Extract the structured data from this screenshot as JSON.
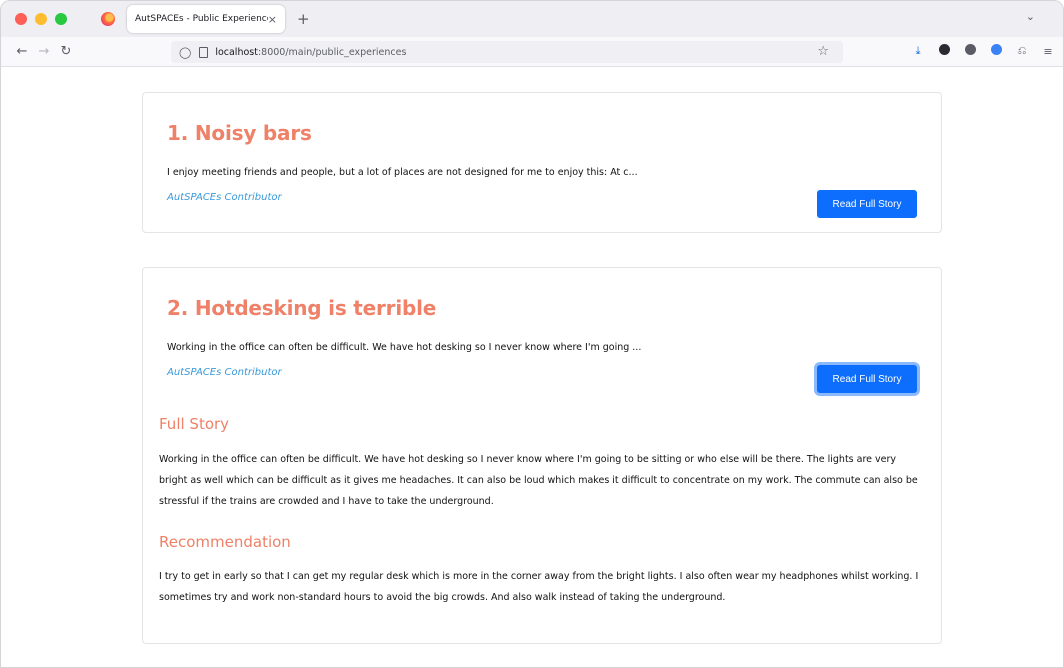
{
  "browser": {
    "tab_title": "AutSPACEs - Public Experiences",
    "tab_close": "×",
    "new_tab": "+",
    "tab_list": "⌄",
    "url_host": "localhost",
    "url_rest": ":8000/main/public_experiences"
  },
  "stories": [
    {
      "title": "1. Noisy bars",
      "excerpt": "I enjoy meeting friends and people, but a lot of places are not designed for me to enjoy this: At c...",
      "author": "AutSPACEs Contributor",
      "button_label": "Read Full Story"
    },
    {
      "title": "2. Hotdesking is terrible",
      "excerpt": "Working in the office can often be difficult. We have hot desking so I never know where I'm going ...",
      "author": "AutSPACEs Contributor",
      "button_label": "Read Full Story",
      "full_story_heading": "Full Story",
      "full_story": "Working in the office can often be difficult. We have hot desking so I never know where I'm going to be sitting or who else will be there. The lights are very bright as well which can be difficult as it gives me headaches. It can also be loud which makes it difficult to concentrate on my work. The commute can also be stressful if the trains are crowded and I have to take the underground.",
      "recommendation_heading": "Recommendation",
      "recommendation": "I try to get in early so that I can get my regular desk which is more in the corner away from the bright lights. I also often wear my headphones whilst working. I sometimes try and work non-standard hours to avoid the big crowds. And also walk instead of taking the underground."
    }
  ],
  "colors": {
    "title": "#ee8168",
    "author": "#3a9ad9",
    "button": "#0d6efd"
  }
}
